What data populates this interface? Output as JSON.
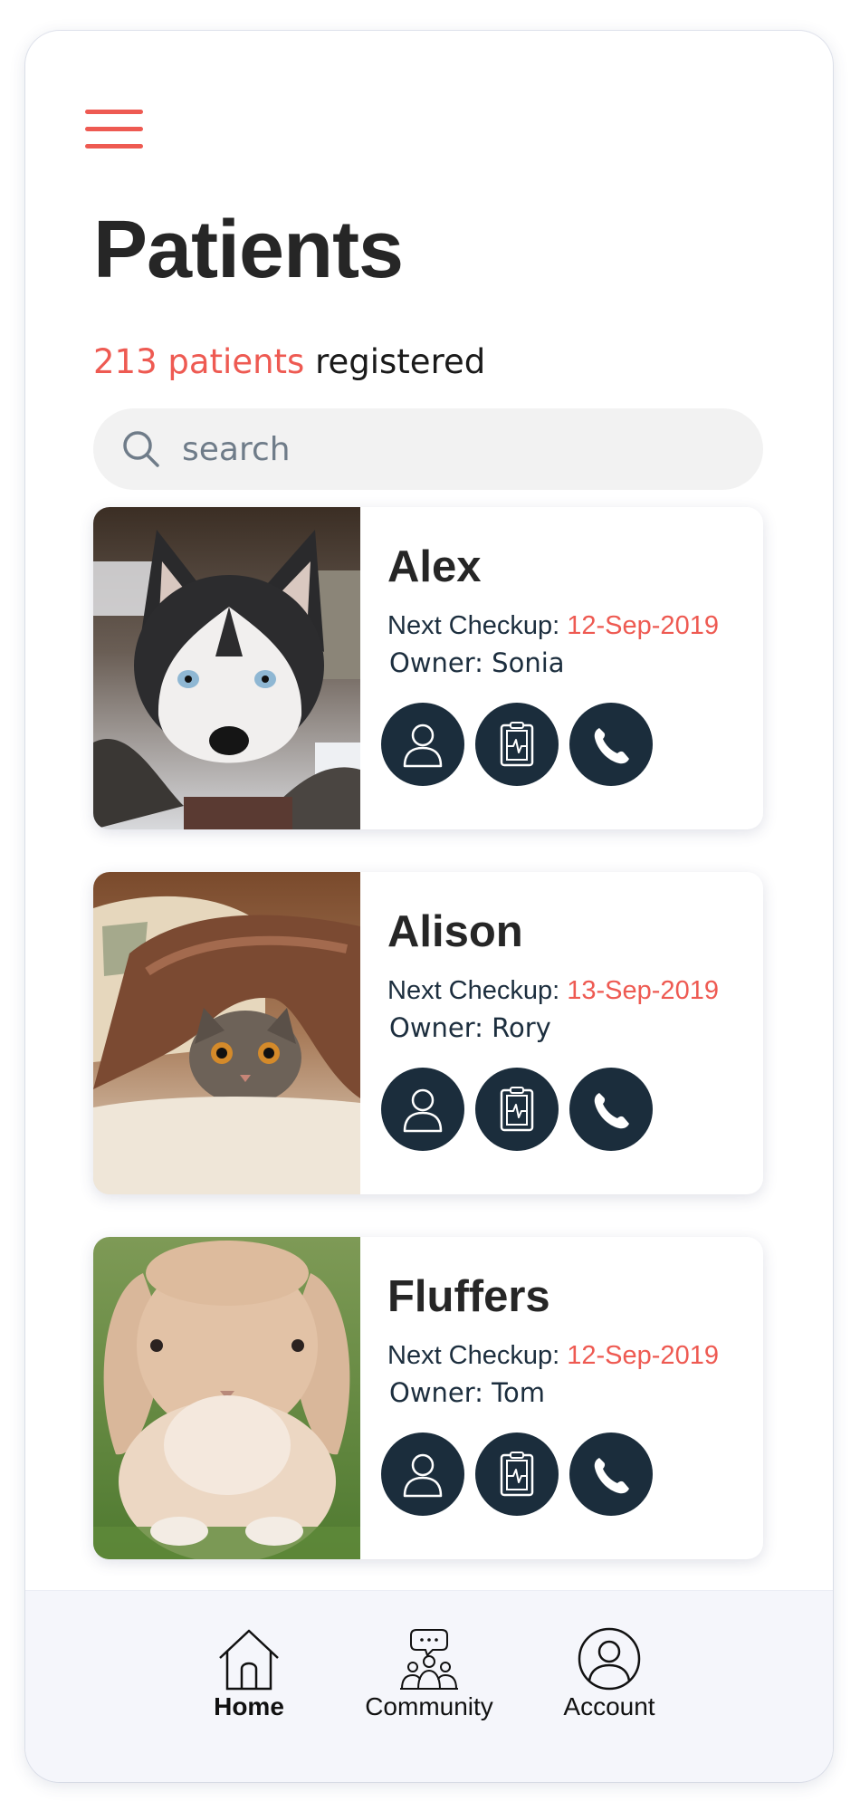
{
  "header": {
    "menu_icon": "hamburger-menu-icon",
    "title": "Patients",
    "count_text": "213 patients",
    "count_suffix": " registered"
  },
  "search": {
    "placeholder": "search",
    "value": "",
    "icon": "search-icon"
  },
  "patients": [
    {
      "name": "Alex",
      "checkup_label": "Next Checkup: ",
      "checkup_date": "12-Sep-2019",
      "owner": "Owner: Sonia",
      "photo": "husky-dog-photo"
    },
    {
      "name": "Alison",
      "checkup_label": "Next Checkup: ",
      "checkup_date": "13-Sep-2019",
      "owner": "Owner: Rory",
      "photo": "cat-under-blanket-photo"
    },
    {
      "name": "Fluffers",
      "checkup_label": "Next Checkup: ",
      "checkup_date": "12-Sep-2019",
      "owner": "Owner: Tom",
      "photo": "lop-rabbit-photo"
    }
  ],
  "card_actions": [
    "owner-profile-icon",
    "medical-record-icon",
    "phone-icon"
  ],
  "bottom_nav": {
    "items": [
      {
        "label": "Home",
        "icon": "home-icon",
        "active": true
      },
      {
        "label": "Community",
        "icon": "community-icon",
        "active": false
      },
      {
        "label": "Account",
        "icon": "account-icon",
        "active": false
      }
    ]
  },
  "colors": {
    "accent": "#ee5a52",
    "dark_navy": "#1b2d3c",
    "title": "#262626",
    "search_bg": "#f2f2f2",
    "nav_bg": "#f5f6fb"
  }
}
